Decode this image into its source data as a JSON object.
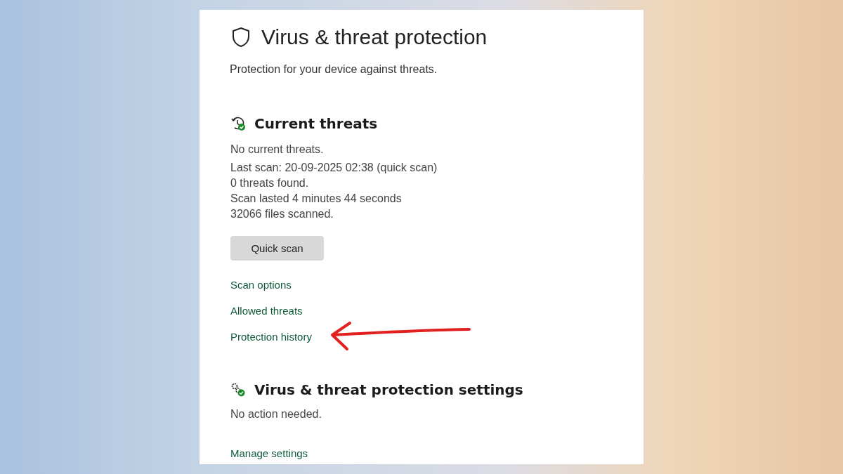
{
  "page": {
    "title": "Virus & threat protection",
    "subtitle": "Protection for your device against threats."
  },
  "current_threats": {
    "title": "Current threats",
    "status": "No current threats.",
    "details": [
      "Last scan: 20-09-2025 02:38 (quick scan)",
      "0 threats found.",
      "Scan lasted 4 minutes 44 seconds",
      "32066 files scanned."
    ],
    "button": "Quick scan",
    "links": [
      {
        "label": "Scan options",
        "highlighted": false
      },
      {
        "label": "Allowed threats",
        "highlighted": false
      },
      {
        "label": "Protection history",
        "highlighted": true
      }
    ]
  },
  "settings_section": {
    "title": "Virus & threat protection settings",
    "status": "No action needed.",
    "link": "Manage settings"
  }
}
